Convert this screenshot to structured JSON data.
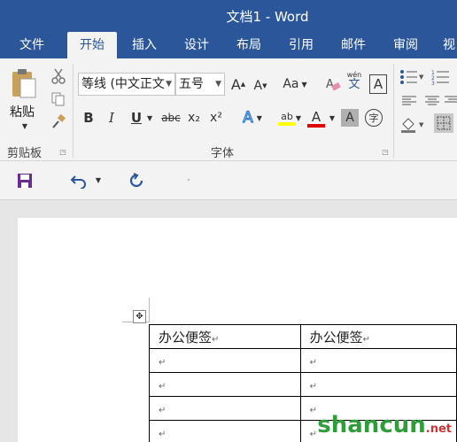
{
  "window": {
    "title": "文档1 - Word"
  },
  "tabs": [
    "文件",
    "开始",
    "插入",
    "设计",
    "布局",
    "引用",
    "邮件",
    "审阅",
    "视"
  ],
  "active_tab": "开始",
  "clipboard": {
    "paste_label": "粘贴",
    "group_label": "剪贴板"
  },
  "font": {
    "name": "等线 (中文正文",
    "size": "五号",
    "group_label": "字体",
    "grow_label": "A",
    "shrink_label": "A",
    "case_label": "Aa",
    "phonetic_top": "wén",
    "phonetic_bottom": "文",
    "border_label": "A",
    "bold_label": "B",
    "italic_label": "I",
    "underline_label": "U",
    "strike_label": "abc",
    "sub_label": "x₂",
    "sup_label": "x²",
    "effects_label": "A",
    "highlight_label": "ab",
    "color_label": "A",
    "shading_label": "A",
    "enclose_label": "字"
  },
  "colors": {
    "accent": "#2b579a",
    "highlight": "#ffff00",
    "font_color": "#e00000",
    "save_icon": "#6a2c91",
    "undo_icon": "#2b579a"
  },
  "document": {
    "table": {
      "rows": [
        [
          "办公便签",
          "办公便签"
        ],
        [
          "",
          ""
        ],
        [
          "",
          ""
        ],
        [
          "",
          ""
        ],
        [
          "",
          ""
        ]
      ],
      "paragraph_mark": "↵"
    }
  },
  "watermark": {
    "text": "shancun",
    "suffix": ".net"
  }
}
